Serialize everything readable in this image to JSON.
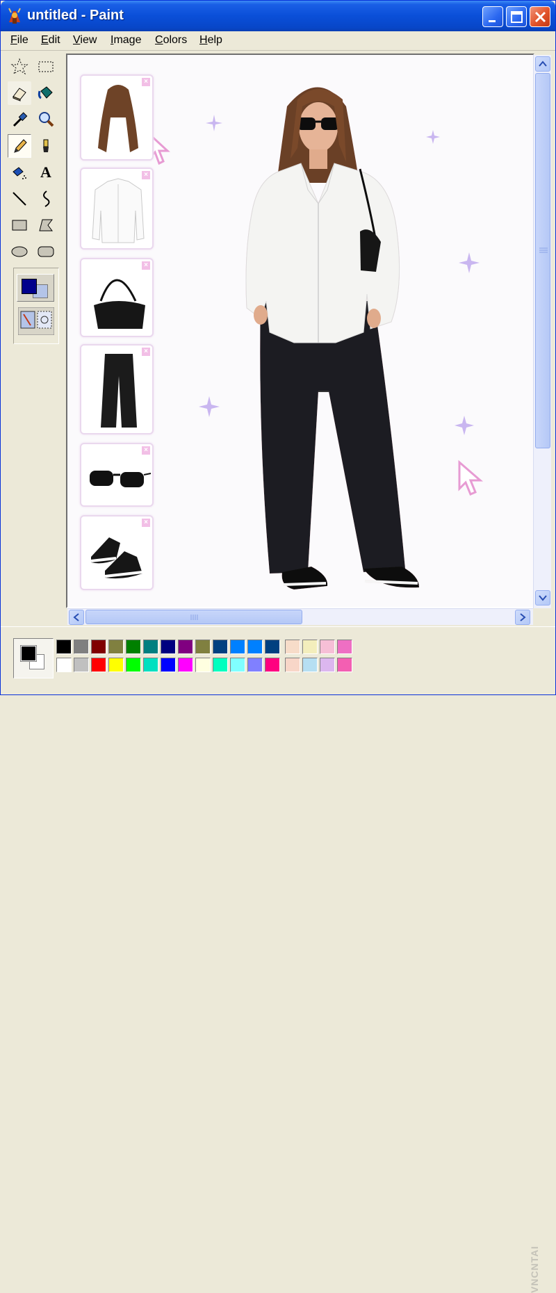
{
  "window": {
    "title": "untitled - Paint",
    "title_bar_color": "#0a4fd8",
    "buttons": [
      "minimize-icon",
      "maximize-icon",
      "close-icon"
    ]
  },
  "menu": [
    "File",
    "Edit",
    "View",
    "Image",
    "Colors",
    "Help"
  ],
  "toolbox": [
    {
      "name": "free-form-select",
      "icon": "star-select-icon"
    },
    {
      "name": "select",
      "icon": "rect-select-icon"
    },
    {
      "name": "eraser",
      "icon": "eraser-icon"
    },
    {
      "name": "fill-with-color",
      "icon": "paint-bucket-icon"
    },
    {
      "name": "pick-color",
      "icon": "eyedropper-icon"
    },
    {
      "name": "magnifier",
      "icon": "magnifier-icon"
    },
    {
      "name": "pencil",
      "icon": "pencil-icon",
      "selected": true
    },
    {
      "name": "brush",
      "icon": "brush-icon"
    },
    {
      "name": "airbrush",
      "icon": "airbrush-icon"
    },
    {
      "name": "text",
      "icon": "text-icon",
      "glyph": "A"
    },
    {
      "name": "line",
      "icon": "line-icon"
    },
    {
      "name": "curve",
      "icon": "curve-icon"
    },
    {
      "name": "rectangle",
      "icon": "rectangle-icon"
    },
    {
      "name": "polygon",
      "icon": "polygon-icon"
    },
    {
      "name": "ellipse",
      "icon": "ellipse-icon"
    },
    {
      "name": "rounded-rectangle",
      "icon": "rounded-rect-icon"
    }
  ],
  "current_colors": {
    "foreground": "#000000",
    "background": "#ffffff"
  },
  "palette_row1": [
    "#000000",
    "#808080",
    "#800000",
    "#808040",
    "#008000",
    "#008080",
    "#000080",
    "#800080",
    "#808040",
    "#004080",
    "#0080ff",
    "#0080ff",
    "#004080",
    "#f7dcc9",
    "#f3eebc",
    "#f6bfd6",
    "#ee6fc3"
  ],
  "palette_row2": [
    "#ffffff",
    "#c0c0c0",
    "#ff0000",
    "#ffff00",
    "#00ff00",
    "#00e0c0",
    "#0000ff",
    "#ff00ff",
    "#ffffe0",
    "#00ffbf",
    "#80ffff",
    "#8080ff",
    "#ff0080",
    "#f8d6c8",
    "#b6dff2",
    "#dcb7ef",
    "#f35fb2"
  ],
  "canvas": {
    "background": "#fbfafc",
    "items": [
      "hair",
      "white-shirt",
      "black-shoulder-bag",
      "black-trousers",
      "sunglasses",
      "sneakers"
    ]
  },
  "watermark": "VNCNTAI"
}
